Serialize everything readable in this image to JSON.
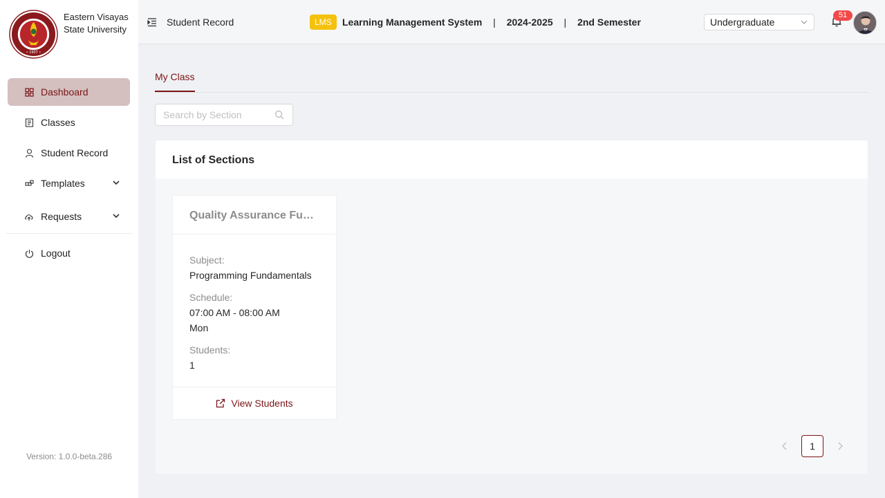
{
  "brand": {
    "name": "Eastern Visayas State University"
  },
  "sidebar": {
    "items": [
      {
        "label": "Dashboard",
        "icon": "dashboard-icon",
        "active": true
      },
      {
        "label": "Classes",
        "icon": "classes-icon"
      },
      {
        "label": "Student Record",
        "icon": "user-icon"
      },
      {
        "label": "Templates",
        "icon": "templates-icon",
        "expandable": true
      },
      {
        "label": "Requests",
        "icon": "cloud-icon",
        "expandable": true
      },
      {
        "label": "Logout",
        "icon": "power-icon"
      }
    ],
    "version": "Version: 1.0.0-beta.286"
  },
  "header": {
    "page_title": "Student Record",
    "badge": "LMS",
    "system_name": "Learning Management System",
    "separator": "|",
    "school_year": "2024-2025",
    "semester": "2nd Semester",
    "level_select": "Undergraduate",
    "notification_count": "51"
  },
  "main": {
    "tab": "My Class",
    "search_placeholder": "Search by Section",
    "panel_title": "List of Sections",
    "cards": [
      {
        "title": "Quality Assurance Fundamentals",
        "subject_label": "Subject:",
        "subject": "Programming Fundamentals",
        "schedule_label": "Schedule:",
        "schedule_time": "07:00 AM - 08:00 AM",
        "schedule_day": "Mon",
        "students_label": "Students:",
        "students": "1",
        "action": "View Students"
      }
    ],
    "pagination": {
      "current": "1"
    }
  },
  "colors": {
    "accent": "#7a1416",
    "badge": "#f4c20d",
    "notification": "#f24a4a",
    "active_nav_bg": "#d3c0bf"
  }
}
